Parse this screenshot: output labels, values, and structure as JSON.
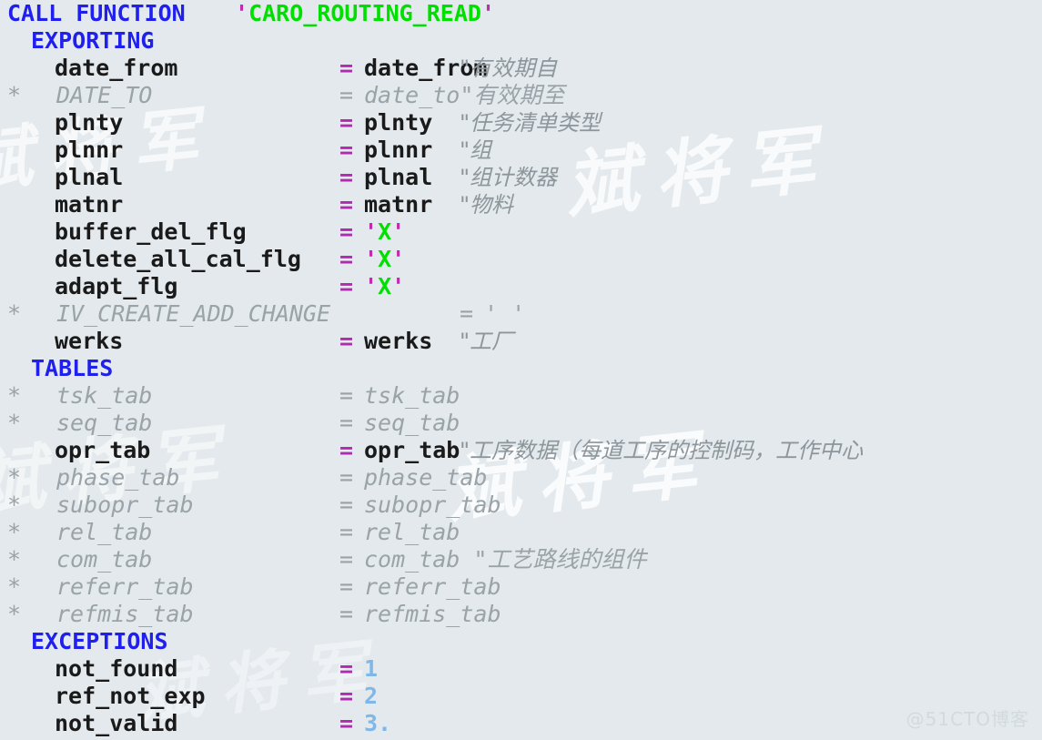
{
  "editor": {
    "background_color": "#e3e9ec",
    "keyword_color": "#2020ee",
    "string_color": "#00e000",
    "operator_color": "#b02bb0",
    "comment_color": "#8d969c",
    "number_color": "#7fb8e8",
    "text_color": "#1a1a1a"
  },
  "watermark": {
    "tiles": [
      "斌将军",
      "斌将军",
      "斌将军",
      "斌将军",
      "斌将军"
    ],
    "corner": "@51CTO博客"
  },
  "code": {
    "lines": [
      {
        "id": "call-function",
        "star": "",
        "kind": "call",
        "keyword": "CALL FUNCTION",
        "quote_open": "'",
        "string": "CARO_ROUTING_READ",
        "quote_close": "'"
      },
      {
        "id": "exporting",
        "star": "",
        "kind": "section",
        "keyword": "EXPORTING"
      },
      {
        "id": "date-from",
        "star": "",
        "kind": "param",
        "name": "date_from",
        "eq": "=",
        "value": "date_from",
        "comment": "\"有效期自"
      },
      {
        "id": "date-to",
        "star": "*",
        "kind": "param-off",
        "name": "DATE_TO",
        "eq": "=",
        "value": "date_to\"有效期至",
        "comment": ""
      },
      {
        "id": "plnty",
        "star": "",
        "kind": "param",
        "name": "plnty",
        "eq": "=",
        "value": "plnty",
        "comment": "\"任务清单类型"
      },
      {
        "id": "plnnr",
        "star": "",
        "kind": "param",
        "name": "plnnr",
        "eq": "=",
        "value": "plnnr",
        "comment": "\"组"
      },
      {
        "id": "plnal",
        "star": "",
        "kind": "param",
        "name": "plnal",
        "eq": "=",
        "value": "plnal",
        "comment": "\"组计数器"
      },
      {
        "id": "matnr",
        "star": "",
        "kind": "param",
        "name": "matnr",
        "eq": "=",
        "value": "matnr",
        "comment": "\"物料"
      },
      {
        "id": "buffer-del-flg",
        "star": "",
        "kind": "param-str",
        "name": "buffer_del_flg",
        "eq": "=",
        "value": "X",
        "comment": ""
      },
      {
        "id": "delete-all-cal-flg",
        "star": "",
        "kind": "param-str",
        "name": "delete_all_cal_flg",
        "eq": "=",
        "value": "X",
        "comment": ""
      },
      {
        "id": "adapt-flg",
        "star": "",
        "kind": "param-str",
        "name": "adapt_flg",
        "eq": "=",
        "value": "X",
        "comment": ""
      },
      {
        "id": "iv-create-add-change",
        "star": "*",
        "kind": "param-off-far",
        "name": "IV_CREATE_ADD_CHANGE",
        "eq": "=",
        "value": "' '",
        "comment": ""
      },
      {
        "id": "werks",
        "star": "",
        "kind": "param",
        "name": "werks",
        "eq": "=",
        "value": "werks",
        "comment": "\"工厂"
      },
      {
        "id": "tables",
        "star": "",
        "kind": "section",
        "keyword": "TABLES"
      },
      {
        "id": "tsk-tab",
        "star": "*",
        "kind": "param-off",
        "name": "tsk_tab",
        "eq": "=",
        "value": "tsk_tab",
        "comment": ""
      },
      {
        "id": "seq-tab",
        "star": "*",
        "kind": "param-off",
        "name": "seq_tab",
        "eq": "=",
        "value": "seq_tab",
        "comment": ""
      },
      {
        "id": "opr-tab",
        "star": "",
        "kind": "param",
        "name": "opr_tab",
        "eq": "=",
        "value": "opr_tab",
        "comment": "\"工序数据（每道工序的控制码，工作中心"
      },
      {
        "id": "phase-tab",
        "star": "*",
        "kind": "param-off",
        "name": "phase_tab",
        "eq": "=",
        "value": "phase_tab",
        "comment": ""
      },
      {
        "id": "subopr-tab",
        "star": "*",
        "kind": "param-off",
        "name": "subopr_tab",
        "eq": "=",
        "value": "subopr_tab",
        "comment": ""
      },
      {
        "id": "rel-tab",
        "star": "*",
        "kind": "param-off",
        "name": "rel_tab",
        "eq": "=",
        "value": "rel_tab",
        "comment": ""
      },
      {
        "id": "com-tab",
        "star": "*",
        "kind": "param-off",
        "name": "com_tab",
        "eq": "=",
        "value": "com_tab \"工艺路线的组件",
        "comment": ""
      },
      {
        "id": "referr-tab",
        "star": "*",
        "kind": "param-off",
        "name": "referr_tab",
        "eq": "=",
        "value": "referr_tab",
        "comment": ""
      },
      {
        "id": "refmis-tab",
        "star": "*",
        "kind": "param-off",
        "name": "refmis_tab",
        "eq": "=",
        "value": "refmis_tab",
        "comment": ""
      },
      {
        "id": "exceptions",
        "star": "",
        "kind": "section",
        "keyword": "EXCEPTIONS"
      },
      {
        "id": "not-found",
        "star": "",
        "kind": "param-num",
        "name": "not_found",
        "eq": "=",
        "value": "1",
        "comment": ""
      },
      {
        "id": "ref-not-exp",
        "star": "",
        "kind": "param-num",
        "name": "ref_not_exp",
        "eq": "=",
        "value": "2",
        "comment": ""
      },
      {
        "id": "not-valid",
        "star": "",
        "kind": "param-num",
        "name": "not_valid",
        "eq": "=",
        "value": "3.",
        "comment": ""
      }
    ]
  }
}
